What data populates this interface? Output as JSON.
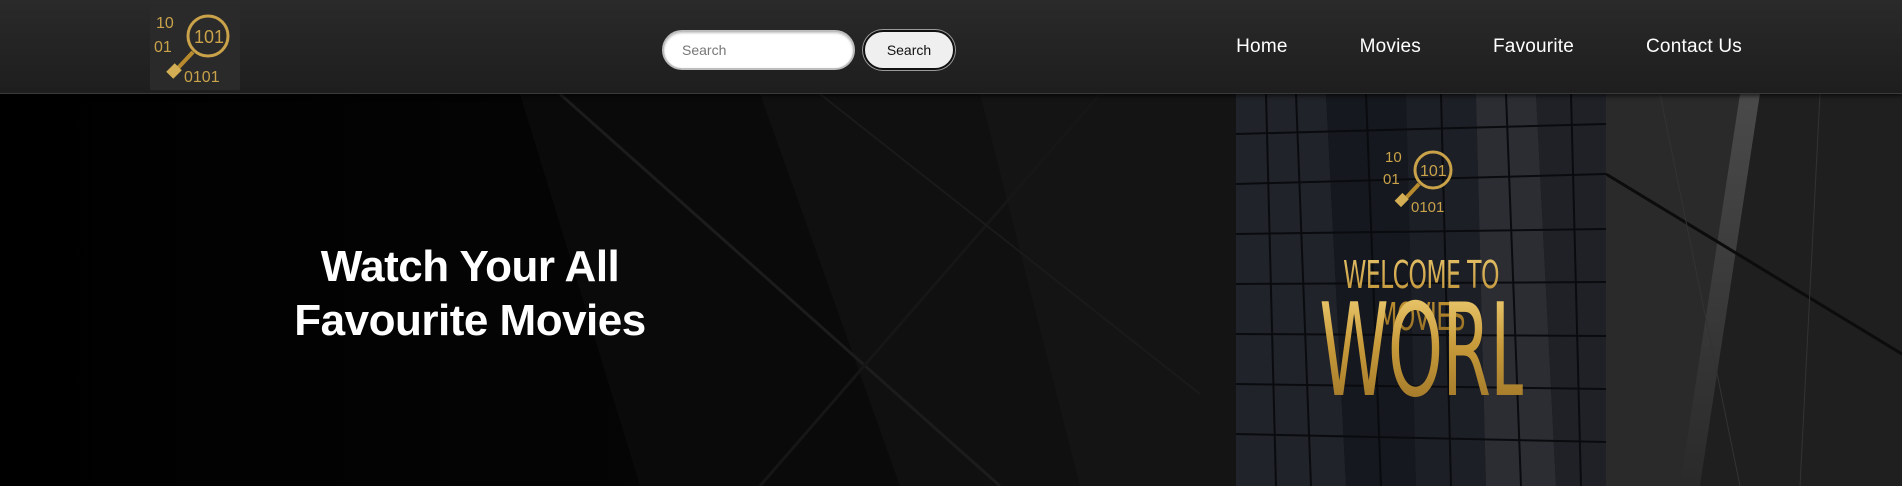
{
  "brand": {
    "logo_digits": [
      "10",
      "01",
      "101",
      "0101"
    ],
    "gold": "#c9a24a"
  },
  "search": {
    "placeholder": "Search",
    "button_label": "Search"
  },
  "nav": {
    "items": [
      {
        "label": "Home"
      },
      {
        "label": "Movies"
      },
      {
        "label": "Favourite"
      },
      {
        "label": "Contact Us"
      }
    ]
  },
  "hero": {
    "title_line1": "Watch Your All",
    "title_line2": "Favourite Movies"
  },
  "poster": {
    "logo_digits": [
      "10",
      "01",
      "101",
      "0101"
    ],
    "welcome_text": "WELCOME TO MOVIES",
    "world_text": "WORLD"
  },
  "colors": {
    "navbar_bg": "#262626",
    "hero_bg": "#000000",
    "text": "#ffffff",
    "gold_light": "#e7c36a",
    "gold_dark": "#9a7126"
  }
}
